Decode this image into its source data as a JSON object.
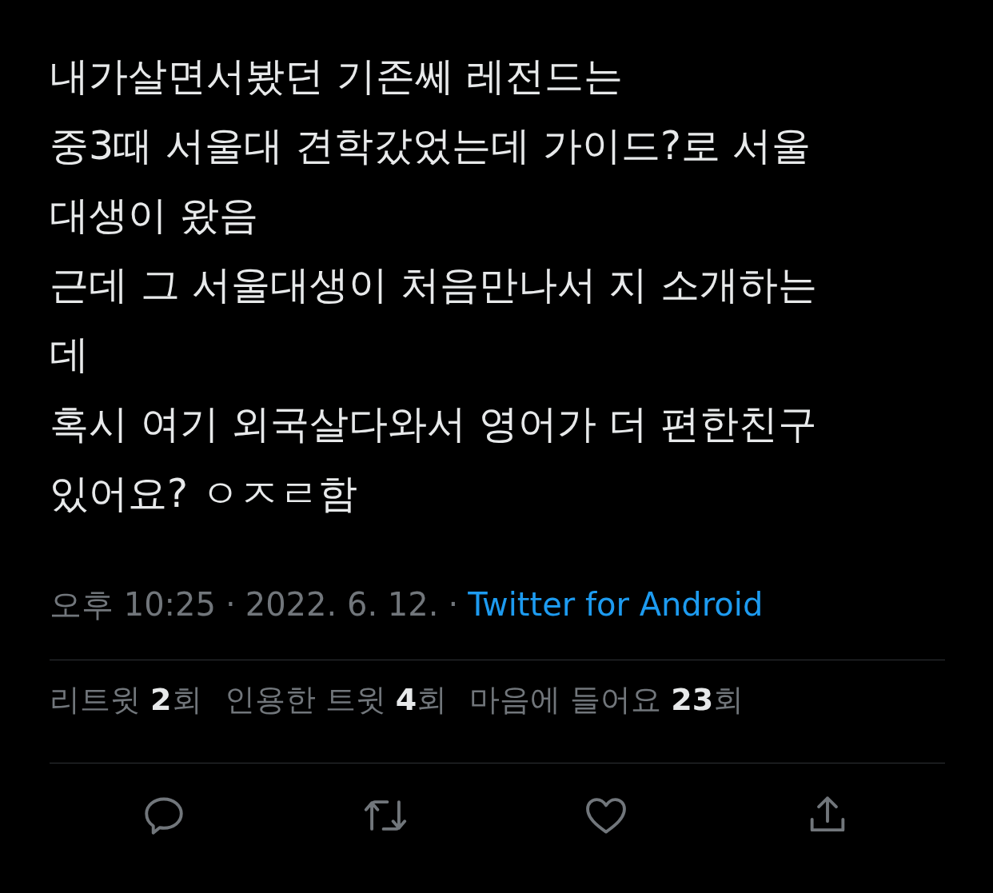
{
  "tweet": {
    "text_lines": [
      "내가살면서봤던 기존쎄 레전드는",
      "중3때 서울대 견학갔었는데 가이드?로 서울",
      "대생이 왔음",
      "근데 그 서울대생이 처음만나서 지 소개하는",
      "데",
      "혹시 여기 외국살다와서 영어가 더 편한친구",
      "있어요? ㅇㅈㄹ함"
    ],
    "time": "오후 10:25",
    "separator_1": "·",
    "date": "2022. 6. 12.",
    "separator_2": "·",
    "source": "Twitter for Android",
    "stats": [
      "리트윗 **2**회",
      "인용한 트윗 **4**회",
      "마음에 들어요 **23**회"
    ],
    "actions": [
      {
        "kind": "reply"
      },
      {
        "kind": "retweet"
      },
      {
        "kind": "like"
      },
      {
        "kind": "share"
      }
    ]
  }
}
